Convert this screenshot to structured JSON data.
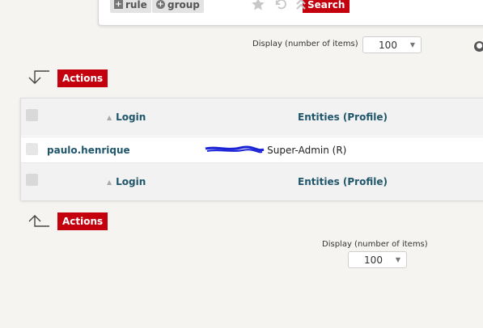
{
  "toolbar": {
    "rule_label": "rule",
    "group_label": "group",
    "search_label": "Search",
    "rule_glyph": "+",
    "group_glyph": "+"
  },
  "display_top": {
    "label": "Display (number of items)",
    "value": "100"
  },
  "display_bottom": {
    "label": "Display (number of items)",
    "value": "100"
  },
  "actions": {
    "top_label": "Actions",
    "bottom_label": "Actions"
  },
  "table": {
    "columns": {
      "login": "Login",
      "entities": "Entities (Profile)"
    },
    "rows": [
      {
        "login": "paulo.henrique",
        "entities": "- Super-Admin (R)"
      }
    ]
  },
  "colors": {
    "accent": "#c4000e",
    "link": "#20566b",
    "redaction": "#1a22d6"
  },
  "icons": [
    "plus-square-icon",
    "plus-circle-icon",
    "star-icon",
    "undo-icon",
    "collapse-icon",
    "globe-icon",
    "arrow-down-left-icon",
    "arrow-up-left-icon",
    "sort-asc-icon",
    "caret-down-icon"
  ]
}
